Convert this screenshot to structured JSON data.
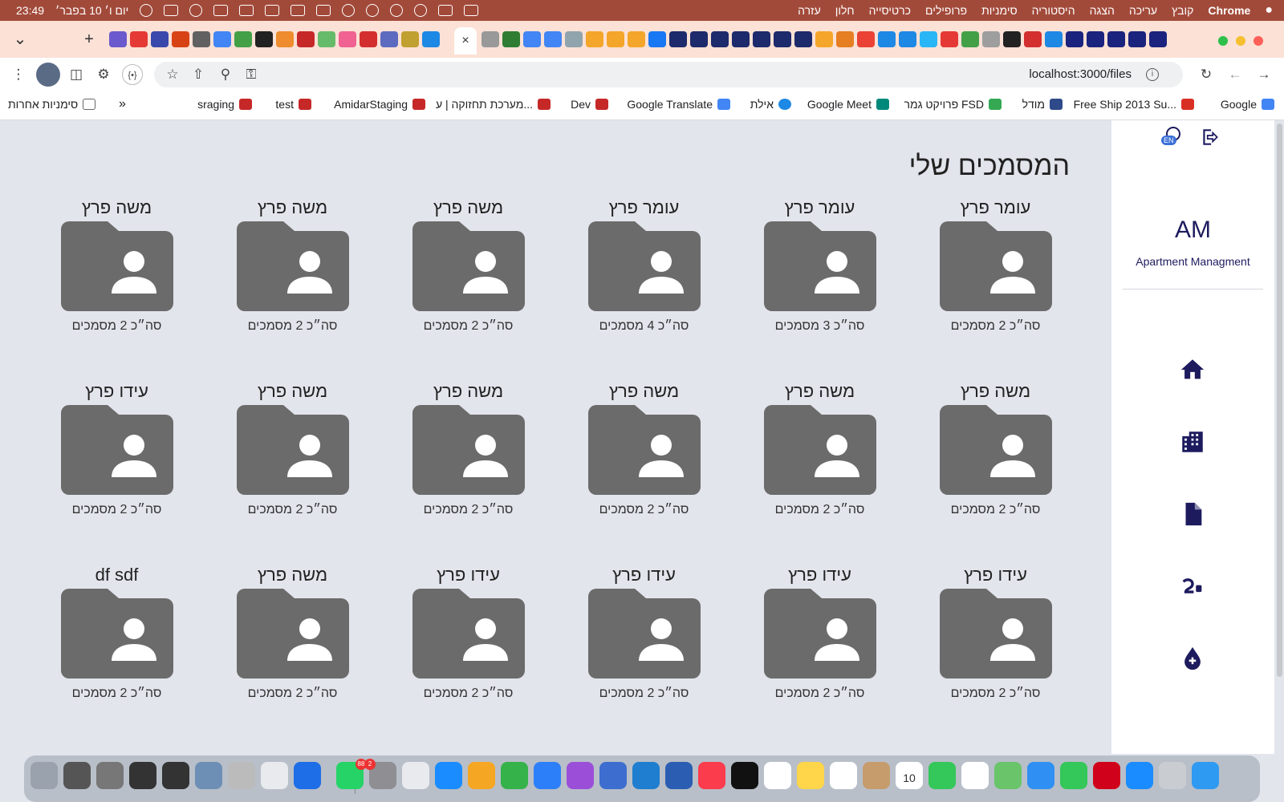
{
  "menubar": {
    "app_name": "Chrome",
    "items": [
      "קובץ",
      "עריכה",
      "הצגה",
      "היסטוריה",
      "סימניות",
      "פרופילים",
      "כרטיסייה",
      "חלון",
      "עזרה"
    ],
    "clock": "23:49",
    "date": "יום ו׳ 10 בפבר׳"
  },
  "browser": {
    "url": "localhost:3000/files",
    "bookmarks": [
      {
        "label": "Google",
        "color": "#4285f4"
      },
      {
        "label": "Free Ship 2013 Su...",
        "color": "#d93025"
      },
      {
        "label": "מודל",
        "color": "#2e4a8a"
      },
      {
        "label": "פרויקט גמר FSD",
        "color": "#34a853"
      },
      {
        "label": "Google Meet",
        "color": "#00897b"
      },
      {
        "label": "אילת",
        "color": "#1e88e5"
      },
      {
        "label": "Google Translate",
        "color": "#4285f4"
      },
      {
        "label": "Dev",
        "color": "#c62828"
      },
      {
        "label": "מערכת תחזוקה | ע...",
        "color": "#c62828"
      },
      {
        "label": "AmidarStaging",
        "color": "#c62828"
      },
      {
        "label": "test",
        "color": "#c62828"
      },
      {
        "label": "sraging",
        "color": "#c62828"
      }
    ],
    "bookmarks_overflow": "»",
    "other_bookmarks": "סימניות אחרות"
  },
  "sidebar": {
    "lang_badge": "EN",
    "logo": "AM",
    "subtitle": "Apartment Managment",
    "nav": [
      "home-icon",
      "building-icon",
      "document-icon",
      "payments-icon",
      "water-drop-icon"
    ],
    "accent_color": "#1d1b5e"
  },
  "page": {
    "title": "המסמכים שלי",
    "folders": [
      {
        "name": "עומר פרץ",
        "count": "סה״כ 2 מסמכים"
      },
      {
        "name": "עומר פרץ",
        "count": "סה״כ 3 מסמכים"
      },
      {
        "name": "עומר פרץ",
        "count": "סה״כ 4 מסמכים"
      },
      {
        "name": "משה פרץ",
        "count": "סה״כ 2 מסמכים"
      },
      {
        "name": "משה פרץ",
        "count": "סה״כ 2 מסמכים"
      },
      {
        "name": "משה פרץ",
        "count": "סה״כ 2 מסמכים"
      },
      {
        "name": "משה פרץ",
        "count": "סה״כ 2 מסמכים"
      },
      {
        "name": "משה פרץ",
        "count": "סה״כ 2 מסמכים"
      },
      {
        "name": "משה פרץ",
        "count": "סה״כ 2 מסמכים"
      },
      {
        "name": "משה פרץ",
        "count": "סה״כ 2 מסמכים"
      },
      {
        "name": "משה פרץ",
        "count": "סה״כ 2 מסמכים"
      },
      {
        "name": "עידו פרץ",
        "count": "סה״כ 2 מסמכים"
      },
      {
        "name": "עידו פרץ",
        "count": "סה״כ 2 מסמכים"
      },
      {
        "name": "עידו פרץ",
        "count": "סה״כ 2 מסמכים"
      },
      {
        "name": "עידו פרץ",
        "count": "סה״כ 2 מסמכים"
      },
      {
        "name": "עידו פרץ",
        "count": "סה״כ 2 מסמכים"
      },
      {
        "name": "משה פרץ",
        "count": "סה״כ 2 מסמכים"
      },
      {
        "name": "df sdf",
        "count": "סה״כ 2 מסמכים"
      }
    ],
    "folder_color": "#6b6b6b"
  },
  "dock": {
    "badges": {
      "whatsapp": "88",
      "settings": "2",
      "calendar": "10"
    }
  }
}
